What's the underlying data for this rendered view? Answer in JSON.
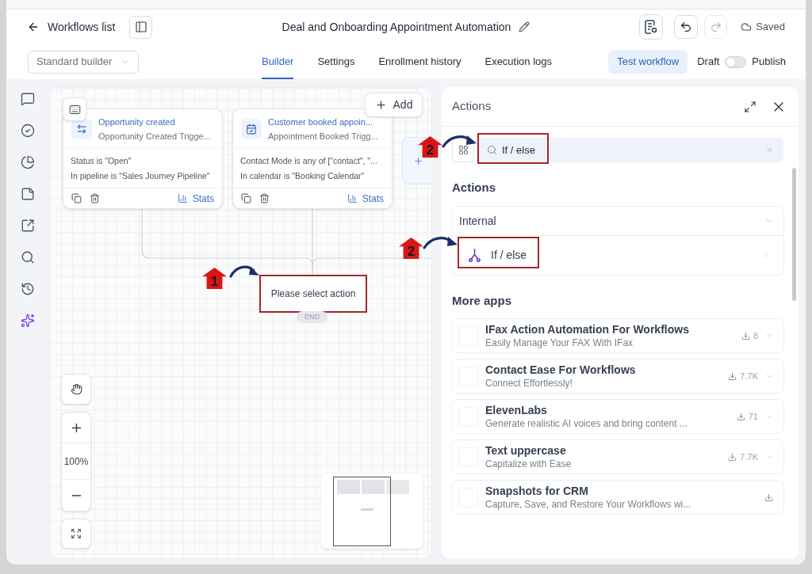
{
  "header": {
    "back_label": "Workflows list",
    "title": "Deal and Onboarding Appointment Automation",
    "history_buttons": [
      {
        "kind": "undo",
        "disabled": false
      },
      {
        "kind": "redo",
        "disabled": true
      }
    ],
    "status": "Saved"
  },
  "toolbar": {
    "builder_select": "Standard builder",
    "tabs": [
      {
        "label": "Builder",
        "selected": true
      },
      {
        "label": "Settings",
        "selected": false
      },
      {
        "label": "Enrollment history",
        "selected": false
      },
      {
        "label": "Execution logs",
        "selected": false
      }
    ],
    "test_button": "Test workflow",
    "publish_toggle": {
      "off_label": "Draft",
      "on_label": "Publish",
      "on": false
    }
  },
  "canvas": {
    "add_button": "Add",
    "triggers": [
      {
        "kind": "opportunity",
        "title": "Opportunity created",
        "subtitle": "Opportunity Created Trigge...",
        "conditions": [
          "Status is \"Open\"",
          "In pipeline is \"Sales Journey Pipeline\""
        ],
        "stats_label": "Stats"
      },
      {
        "kind": "appointment",
        "title": "Customer booked appoin...",
        "subtitle": "Appointment Booked Trigg...",
        "conditions": [
          "Contact Mode is any of [\"contact\", \"...",
          "In calendar is \"Booking Calendar\""
        ],
        "stats_label": "Stats"
      }
    ],
    "action_node": {
      "label": "Please select action",
      "highlighted": true
    },
    "end_label": "END",
    "zoom_level": "100%"
  },
  "actions_panel": {
    "title": "Actions",
    "search": {
      "value": "If / else",
      "highlighted": true
    },
    "actions_heading": "Actions",
    "groups": [
      {
        "label": "Internal",
        "expanded": true,
        "items": [
          {
            "label": "If / else",
            "highlighted": true
          }
        ]
      }
    ],
    "more_apps_heading": "More apps",
    "apps": [
      {
        "name": "IFax Action Automation For Workflows",
        "description": "Easily Manage Your FAX With IFax",
        "downloads": "8"
      },
      {
        "name": "Contact Ease For Workflows",
        "description": "Connect Effortlessly!",
        "downloads": "7.7K"
      },
      {
        "name": "ElevenLabs",
        "description": "Generate realistic AI voices and bring content ...",
        "downloads": "71"
      },
      {
        "name": "Text uppercase",
        "description": "Capitalize with Ease",
        "downloads": "7.7K"
      },
      {
        "name": "Snapshots for CRM",
        "description": "Capture, Save, and Restore Your Workflows wi..."
      }
    ]
  },
  "annotations": [
    {
      "number": "1"
    },
    {
      "number": "2"
    },
    {
      "number": "2"
    }
  ]
}
